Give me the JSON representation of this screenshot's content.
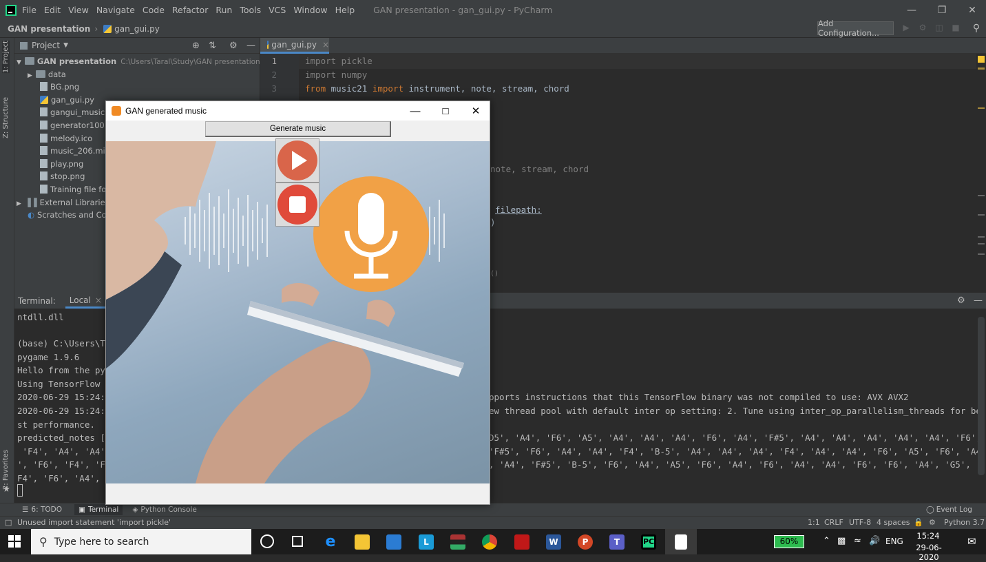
{
  "menu": [
    "File",
    "Edit",
    "View",
    "Navigate",
    "Code",
    "Refactor",
    "Run",
    "Tools",
    "VCS",
    "Window",
    "Help"
  ],
  "window_title": "GAN presentation - gan_gui.py - PyCharm",
  "breadcrumb": {
    "project": "GAN presentation",
    "file": "gan_gui.py"
  },
  "add_configuration": "Add Configuration...",
  "left_strip": {
    "project": "1: Project",
    "structure": "Z: Structure",
    "favorites": "2: Favorites"
  },
  "project_panel": {
    "title": "Project",
    "root": "GAN presentation",
    "root_path": "C:\\Users\\Taral\\Study\\GAN presentation",
    "items": [
      "data",
      "BG.png",
      "gan_gui.py",
      "gangui_music.ip",
      "generator100.h5",
      "melody.ico",
      "music_206.mid",
      "play.png",
      "stop.png",
      "Training file for"
    ],
    "external": "External Libraries",
    "scratches": "Scratches and Cons"
  },
  "editor": {
    "tab": "gan_gui.py",
    "line_numbers": [
      "1",
      "2",
      "3"
    ],
    "lines": [
      "import pickle",
      "import numpy",
      "from music21 import instrument, note, stream, chord"
    ],
    "fragments": {
      "f1": "note, stream, chord",
      "f2": "filepath:",
      "f3": ")",
      "f4": "()"
    }
  },
  "terminal": {
    "label": "Terminal:",
    "tab": "Local",
    "lines": [
      "ntdll.dll",
      "",
      "(base) C:\\Users\\T",
      "pygame 1.9.6",
      "Hello from the py",
      "Using TensorFlow ",
      "2020-06-29 15:24:",
      "2020-06-29 15:24:",
      "st performance.",
      "predicted_notes [",
      " 'F4', 'A4', 'A4'",
      "', 'F6', 'F4', 'F",
      "F4', 'F6', 'A4', "
    ],
    "right_lines": [
      "pports instructions that this TensorFlow binary was not compiled to use: AVX AVX2",
      "ew thread pool with default inter op setting: 2. Tune using inter_op_parallelism_threads for be",
      "",
      "D5', 'A4', 'F6', 'A5', 'A4', 'A4', 'A4', 'F6', 'A4', 'F#5', 'A4', 'A4', 'A4', 'A4', 'A4', 'F6',",
      "'F#5', 'F6', 'A4', 'A4', 'F4', 'B-5', 'A4', 'A4', 'A4', 'F4', 'A4', 'A4', 'F6', 'A5', 'F6', 'A4",
      ", 'A4', 'F#5', 'B-5', 'F6', 'A4', 'A5', 'F6', 'A4', 'F6', 'A4', 'A4', 'F6', 'F6', 'A4', 'G5', '"
    ]
  },
  "bottom_tabs": {
    "todo": "6: TODO",
    "terminal": "Terminal",
    "python_console": "Python Console",
    "event_log": "Event Log"
  },
  "status": {
    "message": "Unused import statement 'import pickle'",
    "position": "1:1",
    "line_sep": "CRLF",
    "encoding": "UTF-8",
    "indent": "4 spaces",
    "interpreter": "Python 3.7"
  },
  "dialog": {
    "title": "GAN generated music",
    "generate_label": "Generate music"
  },
  "taskbar": {
    "search_placeholder": "Type here to search",
    "battery": "60%",
    "lang": "ENG",
    "time": "15:24",
    "date": "29-06-2020"
  }
}
